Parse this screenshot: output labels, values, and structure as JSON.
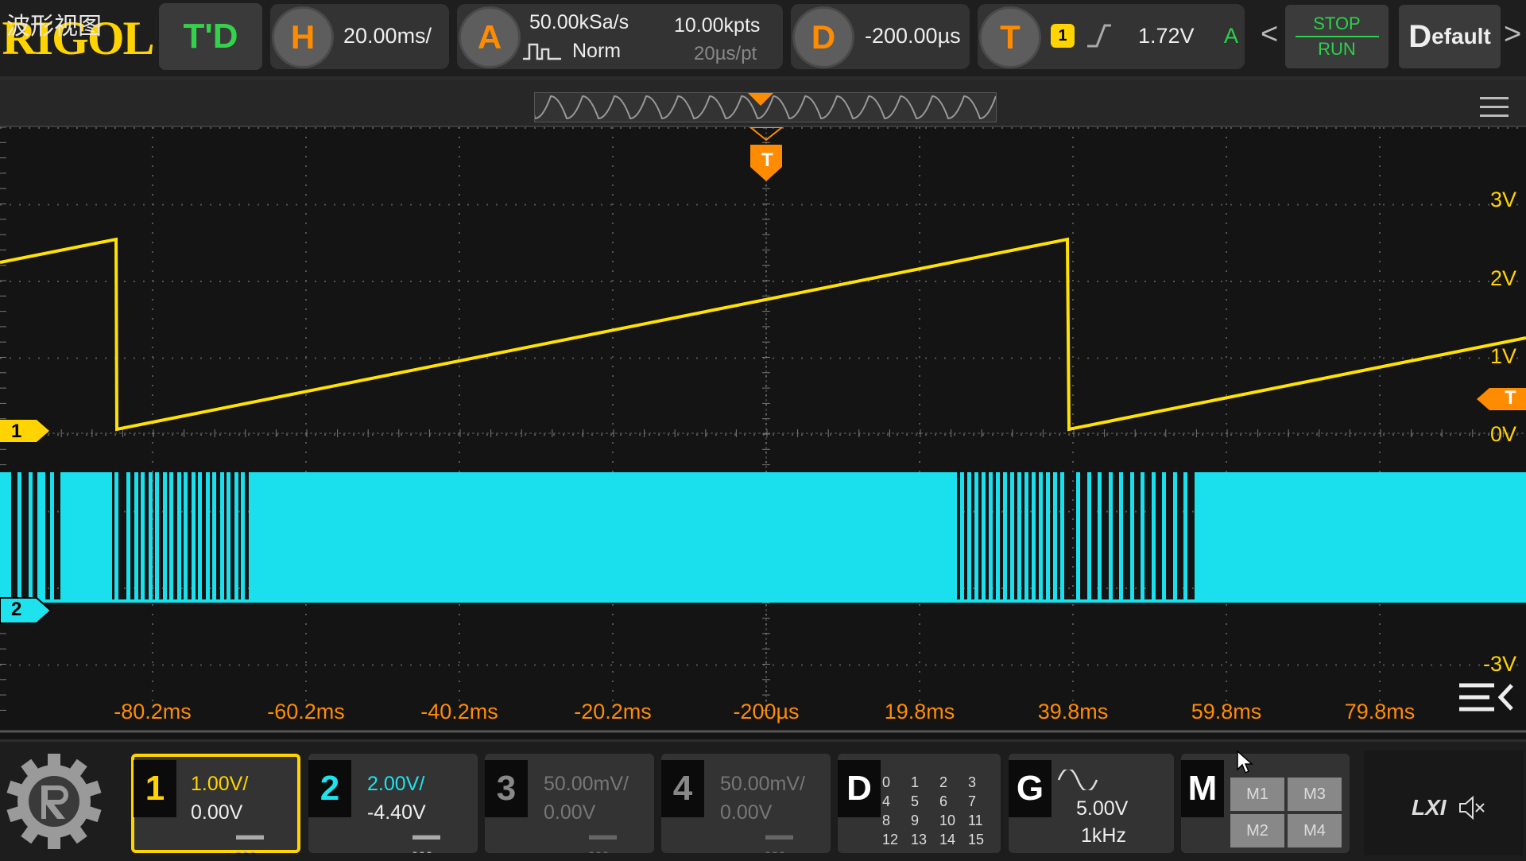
{
  "topbar": {
    "brand": "RIGOL",
    "mode": "T'D",
    "horizontal": {
      "key": "H",
      "scale": "20.00ms/"
    },
    "acquire": {
      "key": "A",
      "sample_rate": "50.00kSa/s",
      "mode": "Norm",
      "memory_depth": "10.00kpts",
      "time_per_point": "20µs/pt"
    },
    "delay": {
      "key": "D",
      "value": "-200.00µs"
    },
    "trigger": {
      "key": "T",
      "source": "1",
      "level": "1.72V",
      "sweep": "A"
    },
    "stop_label": "STOP",
    "run_label": "RUN",
    "default_label_d": "D",
    "default_label_rest": "efault",
    "nav_left": "<",
    "nav_right": ">"
  },
  "view": {
    "title": "波形视图"
  },
  "waveform": {
    "trigger_marker": "T",
    "voltage_labels": [
      "3V",
      "2V",
      "1V",
      "0V",
      "-3V"
    ],
    "time_labels": [
      "-80.2ms",
      "-60.2ms",
      "-40.2ms",
      "-20.2ms",
      "-200µs",
      "19.8ms",
      "39.8ms",
      "59.8ms",
      "79.8ms"
    ],
    "ch1_marker": "1",
    "ch2_marker": "2",
    "trigger_level_marker": "T"
  },
  "channels": [
    {
      "num": "1",
      "scale": "1.00V/",
      "offset": "0.00V",
      "color": "#ffd400",
      "active": true
    },
    {
      "num": "2",
      "scale": "2.00V/",
      "offset": "-4.40V",
      "color": "#1ee3ee",
      "active": true
    },
    {
      "num": "3",
      "scale": "50.00mV/",
      "offset": "0.00V",
      "color": "#777777",
      "active": false
    },
    {
      "num": "4",
      "scale": "50.00mV/",
      "offset": "0.00V",
      "color": "#777777",
      "active": false
    }
  ],
  "digital": {
    "key": "D",
    "bits": [
      "0",
      "1",
      "2",
      "3",
      "4",
      "5",
      "6",
      "7",
      "8",
      "9",
      "10",
      "11",
      "12",
      "13",
      "14",
      "15"
    ]
  },
  "generator": {
    "key": "G",
    "amplitude": "5.00V",
    "frequency": "1kHz"
  },
  "math": {
    "key": "M",
    "slots": [
      "M1",
      "M3",
      "M2",
      "M4"
    ]
  },
  "lxi_label": "LXI",
  "colors": {
    "ch1": "#ffd400",
    "ch2": "#1ee3ee",
    "trigger": "#ff8c00",
    "run": "#2ad34a"
  }
}
